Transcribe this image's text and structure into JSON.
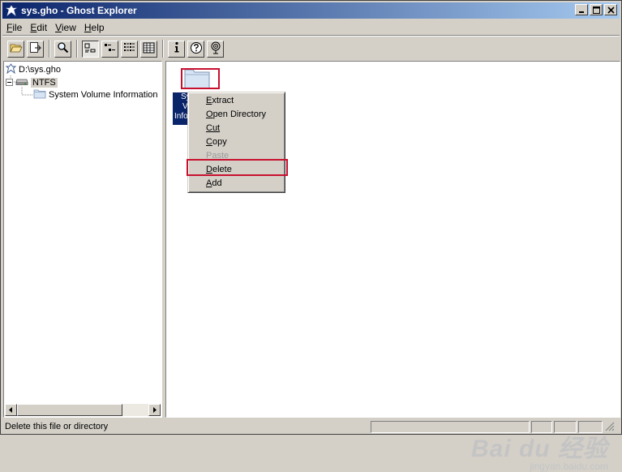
{
  "window": {
    "title": "sys.gho - Ghost Explorer",
    "controls": {
      "minimize": "_",
      "maximize": "□",
      "close": "×"
    }
  },
  "menubar": {
    "items": [
      {
        "label": "File",
        "mnemonic": "F",
        "rest": "ile"
      },
      {
        "label": "Edit",
        "mnemonic": "E",
        "rest": "dit"
      },
      {
        "label": "View",
        "mnemonic": "V",
        "rest": "iew"
      },
      {
        "label": "Help",
        "mnemonic": "H",
        "rest": "elp"
      }
    ]
  },
  "toolbar": {
    "buttons": [
      {
        "icon": "open-folder-icon"
      },
      {
        "icon": "extract-icon"
      },
      {
        "icon": "search-icon"
      },
      {
        "icon": "large-icons-view-icon",
        "pressed": true
      },
      {
        "icon": "small-icons-view-icon"
      },
      {
        "icon": "list-view-icon"
      },
      {
        "icon": "details-view-icon"
      },
      {
        "icon": "info-icon"
      },
      {
        "icon": "help-icon"
      },
      {
        "icon": "network-icon"
      }
    ]
  },
  "tree": {
    "root": "D:\\sys.gho",
    "partition": "NTFS",
    "child": "System Volume Information"
  },
  "content": {
    "folder_label_lines": [
      "Sy",
      "Vo",
      "Info"
    ]
  },
  "context_menu": {
    "items": [
      {
        "label": "Extract",
        "u": "E",
        "rest": "xtract",
        "disabled": false
      },
      {
        "label": "Open Directory",
        "u": "O",
        "rest": "pen Directory",
        "disabled": false
      },
      {
        "label": "Cut",
        "u": "C",
        "rest": "ut",
        "disabled": false,
        "upos": 2,
        "pre": "Cu",
        "post": ""
      },
      {
        "label": "Copy",
        "u": "C",
        "rest": "opy",
        "disabled": false
      },
      {
        "label": "Paste",
        "u": "P",
        "rest": "aste",
        "disabled": true
      },
      {
        "label": "Delete",
        "u": "D",
        "rest": "elete",
        "disabled": false
      },
      {
        "label": "Add",
        "u": "A",
        "rest": "dd",
        "disabled": false
      }
    ]
  },
  "statusbar": {
    "text": "Delete this file or directory"
  },
  "watermark": {
    "main": "Bai du 经验",
    "sub": "jingyan.baidu.com"
  },
  "colors": {
    "accent_highlight": "#c8102e",
    "selection": "#0a246a",
    "titlebar_start": "#0a246a",
    "titlebar_end": "#a6caf0"
  }
}
